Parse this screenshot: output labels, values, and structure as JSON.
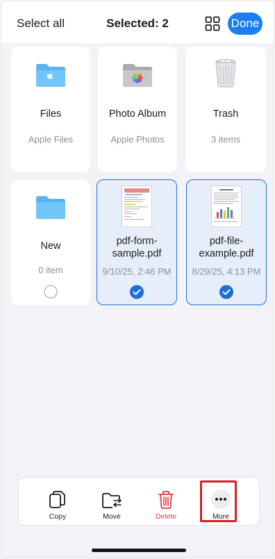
{
  "header": {
    "select_all": "Select all",
    "title": "Selected: 2",
    "done_label": "Done"
  },
  "items": [
    {
      "name": "Files",
      "sub": "Apple Files",
      "icon": "folder-apple-icon",
      "selected": false
    },
    {
      "name": "Photo Album",
      "sub": "Apple Photos",
      "icon": "photos-folder-icon",
      "selected": false
    },
    {
      "name": "Trash",
      "sub": "3 items",
      "icon": "trash-can-icon",
      "selected": false
    },
    {
      "name": "New",
      "sub": "0 item",
      "icon": "folder-icon",
      "selected": false
    },
    {
      "name": "pdf-form-sample.pdf",
      "sub": "9/10/25, 2:46 PM",
      "icon": "pdf-thumbnail-icon",
      "selected": true
    },
    {
      "name": "pdf-file-example.pdf",
      "sub": "8/29/25, 4:13 PM",
      "icon": "pdf-thumbnail-icon",
      "selected": true
    }
  ],
  "item_names": {
    "a": "pdf-form-",
    "b": "sample.pdf",
    "c": "pdf-file-",
    "d": "example.pdf"
  },
  "toolbar": {
    "copy_label": "Copy",
    "move_label": "Move",
    "delete_label": "Delete",
    "more_label": "More"
  },
  "colors": {
    "accent": "#1a7ff3",
    "selected_bg": "#e6eef9",
    "danger": "#e0393e",
    "highlight": "#d61f26"
  }
}
